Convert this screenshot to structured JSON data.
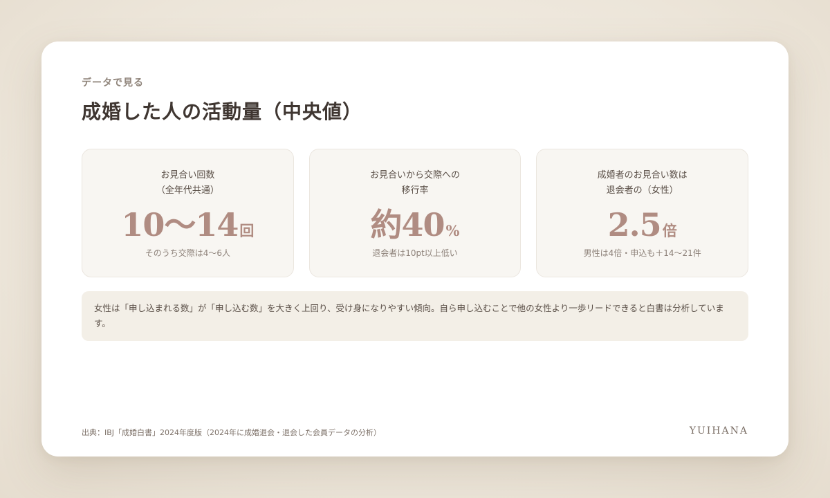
{
  "header": {
    "eyebrow": "データで見る",
    "title": "成婚した人の活動量（中央値）"
  },
  "stats": [
    {
      "label_line1": "お見合い回数",
      "label_line2": "（全年代共通）",
      "value": "10〜14",
      "unit": "回",
      "note": "そのうち交際は4〜6人"
    },
    {
      "label_line1": "お見合いから交際への",
      "label_line2": "移行率",
      "value": "約40",
      "unit": "%",
      "note": "退会者は10pt以上低い"
    },
    {
      "label_line1": "成婚者のお見合い数は",
      "label_line2": "退会者の（女性）",
      "value": "2.5",
      "unit": "倍",
      "note": "男性は4倍・申込も＋14〜21件"
    }
  ],
  "note": "女性は「申し込まれる数」が「申し込む数」を大きく上回り、受け身になりやすい傾向。自ら申し込むことで他の女性より一歩リードできると白書は分析しています。",
  "footer": {
    "source": "出典：IBJ「成婚白書」2024年度版（2024年に成婚退会・退会した会員データの分析）",
    "brand": "YUIHANA"
  },
  "colors": {
    "accent": "#b08c82",
    "text": "#3f3631",
    "panel": "#f8f6f2",
    "note_bg": "#f3efe7"
  }
}
